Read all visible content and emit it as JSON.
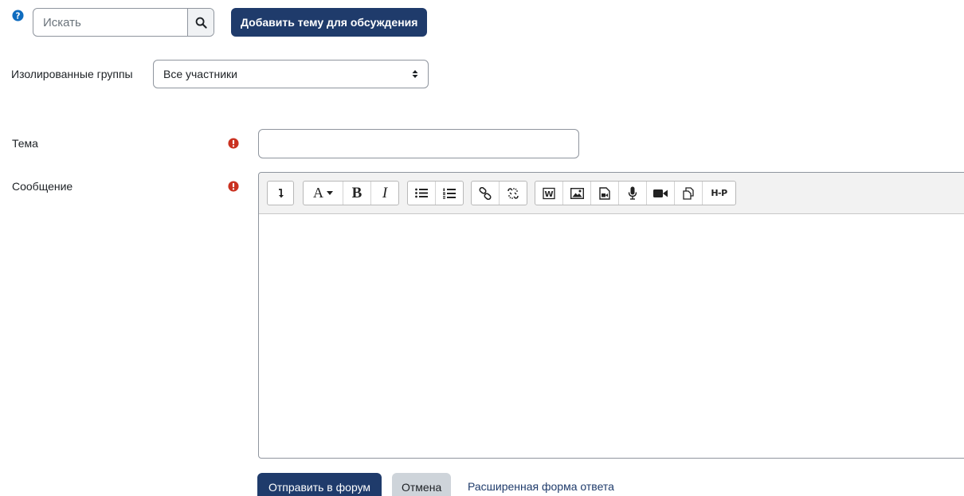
{
  "search": {
    "placeholder": "Искать",
    "value": ""
  },
  "actions": {
    "add_topic_label": "Добавить тему для обсуждения"
  },
  "groups": {
    "label": "Изолированные группы",
    "selected": "Все участники"
  },
  "form": {
    "subject_label": "Тема",
    "subject_value": "",
    "message_label": "Сообщение",
    "toolbar": [
      "show-more-icon",
      "font-style-icon",
      "bold-icon",
      "italic-icon",
      "unordered-list-icon",
      "ordered-list-icon",
      "link-icon",
      "unlink-icon",
      "word-import-icon",
      "image-icon",
      "media-icon",
      "record-audio-icon",
      "record-video-icon",
      "manage-files-icon",
      "h5p-icon"
    ],
    "toolbar_text": {
      "bold": "B",
      "italic": "I",
      "font": "A",
      "h5p": "H-P"
    }
  },
  "buttons": {
    "submit_label": "Отправить в форум",
    "cancel_label": "Отмена",
    "advanced_label": "Расширенная форма ответа"
  },
  "colors": {
    "primary": "#1f3b6b",
    "required": "#ca3120",
    "help": "#0f6cbf"
  }
}
